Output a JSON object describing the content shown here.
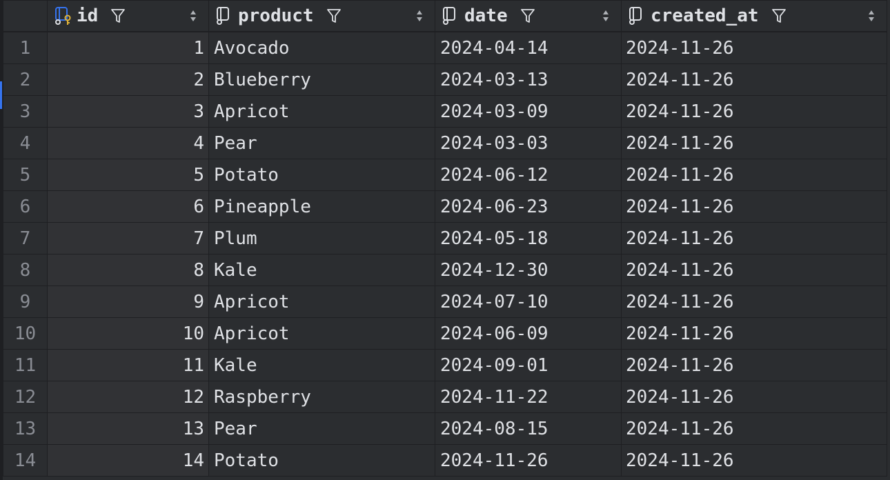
{
  "colors": {
    "background": "#2b2d30",
    "grid_line": "#1e1f22",
    "id_column_background": "#313235",
    "text": "#dfe1e5",
    "row_number_text": "#8a8d94",
    "key_icon_accent": "#e0b43a",
    "id_icon_accent": "#3574f0"
  },
  "columns": [
    {
      "name": "id",
      "icon": "primary-key-column-icon"
    },
    {
      "name": "product",
      "icon": "column-icon"
    },
    {
      "name": "date",
      "icon": "column-icon"
    },
    {
      "name": "created_at",
      "icon": "column-icon"
    }
  ],
  "rows": [
    {
      "num": "1",
      "id": "1",
      "product": "Avocado",
      "date": "2024-04-14",
      "created_at": "2024-11-26"
    },
    {
      "num": "2",
      "id": "2",
      "product": "Blueberry",
      "date": "2024-03-13",
      "created_at": "2024-11-26"
    },
    {
      "num": "3",
      "id": "3",
      "product": "Apricot",
      "date": "2024-03-09",
      "created_at": "2024-11-26"
    },
    {
      "num": "4",
      "id": "4",
      "product": "Pear",
      "date": "2024-03-03",
      "created_at": "2024-11-26"
    },
    {
      "num": "5",
      "id": "5",
      "product": "Potato",
      "date": "2024-06-12",
      "created_at": "2024-11-26"
    },
    {
      "num": "6",
      "id": "6",
      "product": "Pineapple",
      "date": "2024-06-23",
      "created_at": "2024-11-26"
    },
    {
      "num": "7",
      "id": "7",
      "product": "Plum",
      "date": "2024-05-18",
      "created_at": "2024-11-26"
    },
    {
      "num": "8",
      "id": "8",
      "product": "Kale",
      "date": "2024-12-30",
      "created_at": "2024-11-26"
    },
    {
      "num": "9",
      "id": "9",
      "product": "Apricot",
      "date": "2024-07-10",
      "created_at": "2024-11-26"
    },
    {
      "num": "10",
      "id": "10",
      "product": "Apricot",
      "date": "2024-06-09",
      "created_at": "2024-11-26"
    },
    {
      "num": "11",
      "id": "11",
      "product": "Kale",
      "date": "2024-09-01",
      "created_at": "2024-11-26"
    },
    {
      "num": "12",
      "id": "12",
      "product": "Raspberry",
      "date": "2024-11-22",
      "created_at": "2024-11-26"
    },
    {
      "num": "13",
      "id": "13",
      "product": "Pear",
      "date": "2024-08-15",
      "created_at": "2024-11-26"
    },
    {
      "num": "14",
      "id": "14",
      "product": "Potato",
      "date": "2024-11-26",
      "created_at": "2024-11-26"
    }
  ]
}
